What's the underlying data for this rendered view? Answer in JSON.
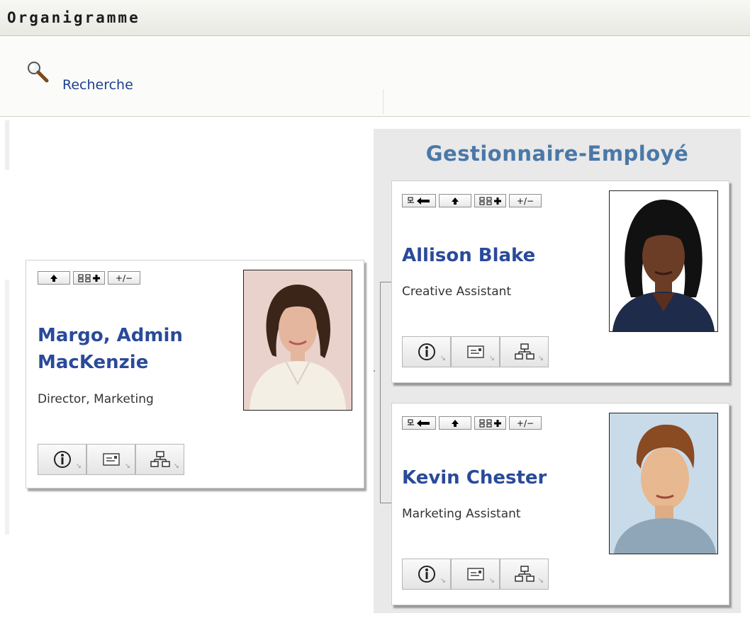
{
  "header": {
    "title": "Organigramme"
  },
  "toolbar": {
    "search_label": "Recherche",
    "search_icon": "magnifier-icon"
  },
  "panel": {
    "title": "Gestionnaire-Employé"
  },
  "cards": {
    "manager": {
      "name_line1": "Margo, Admin",
      "name_line2": "MacKenzie",
      "job_title": "Director, Marketing",
      "toolbar": [
        "↑",
        "org+",
        "+/−"
      ],
      "actions": [
        "info-icon",
        "vcard-icon",
        "org-chart-icon"
      ]
    },
    "employee1": {
      "name": "Allison Blake",
      "job_title": "Creative Assistant",
      "toolbar": [
        "person-back",
        "↑",
        "org+",
        "+/−"
      ],
      "actions": [
        "info-icon",
        "vcard-icon",
        "org-chart-icon"
      ]
    },
    "employee2": {
      "name": "Kevin Chester",
      "job_title": "Marketing Assistant",
      "toolbar": [
        "person-back",
        "↑",
        "org+",
        "+/−"
      ],
      "actions": [
        "info-icon",
        "vcard-icon",
        "org-chart-icon"
      ]
    }
  },
  "labels": {
    "plus_minus": "+/−"
  }
}
